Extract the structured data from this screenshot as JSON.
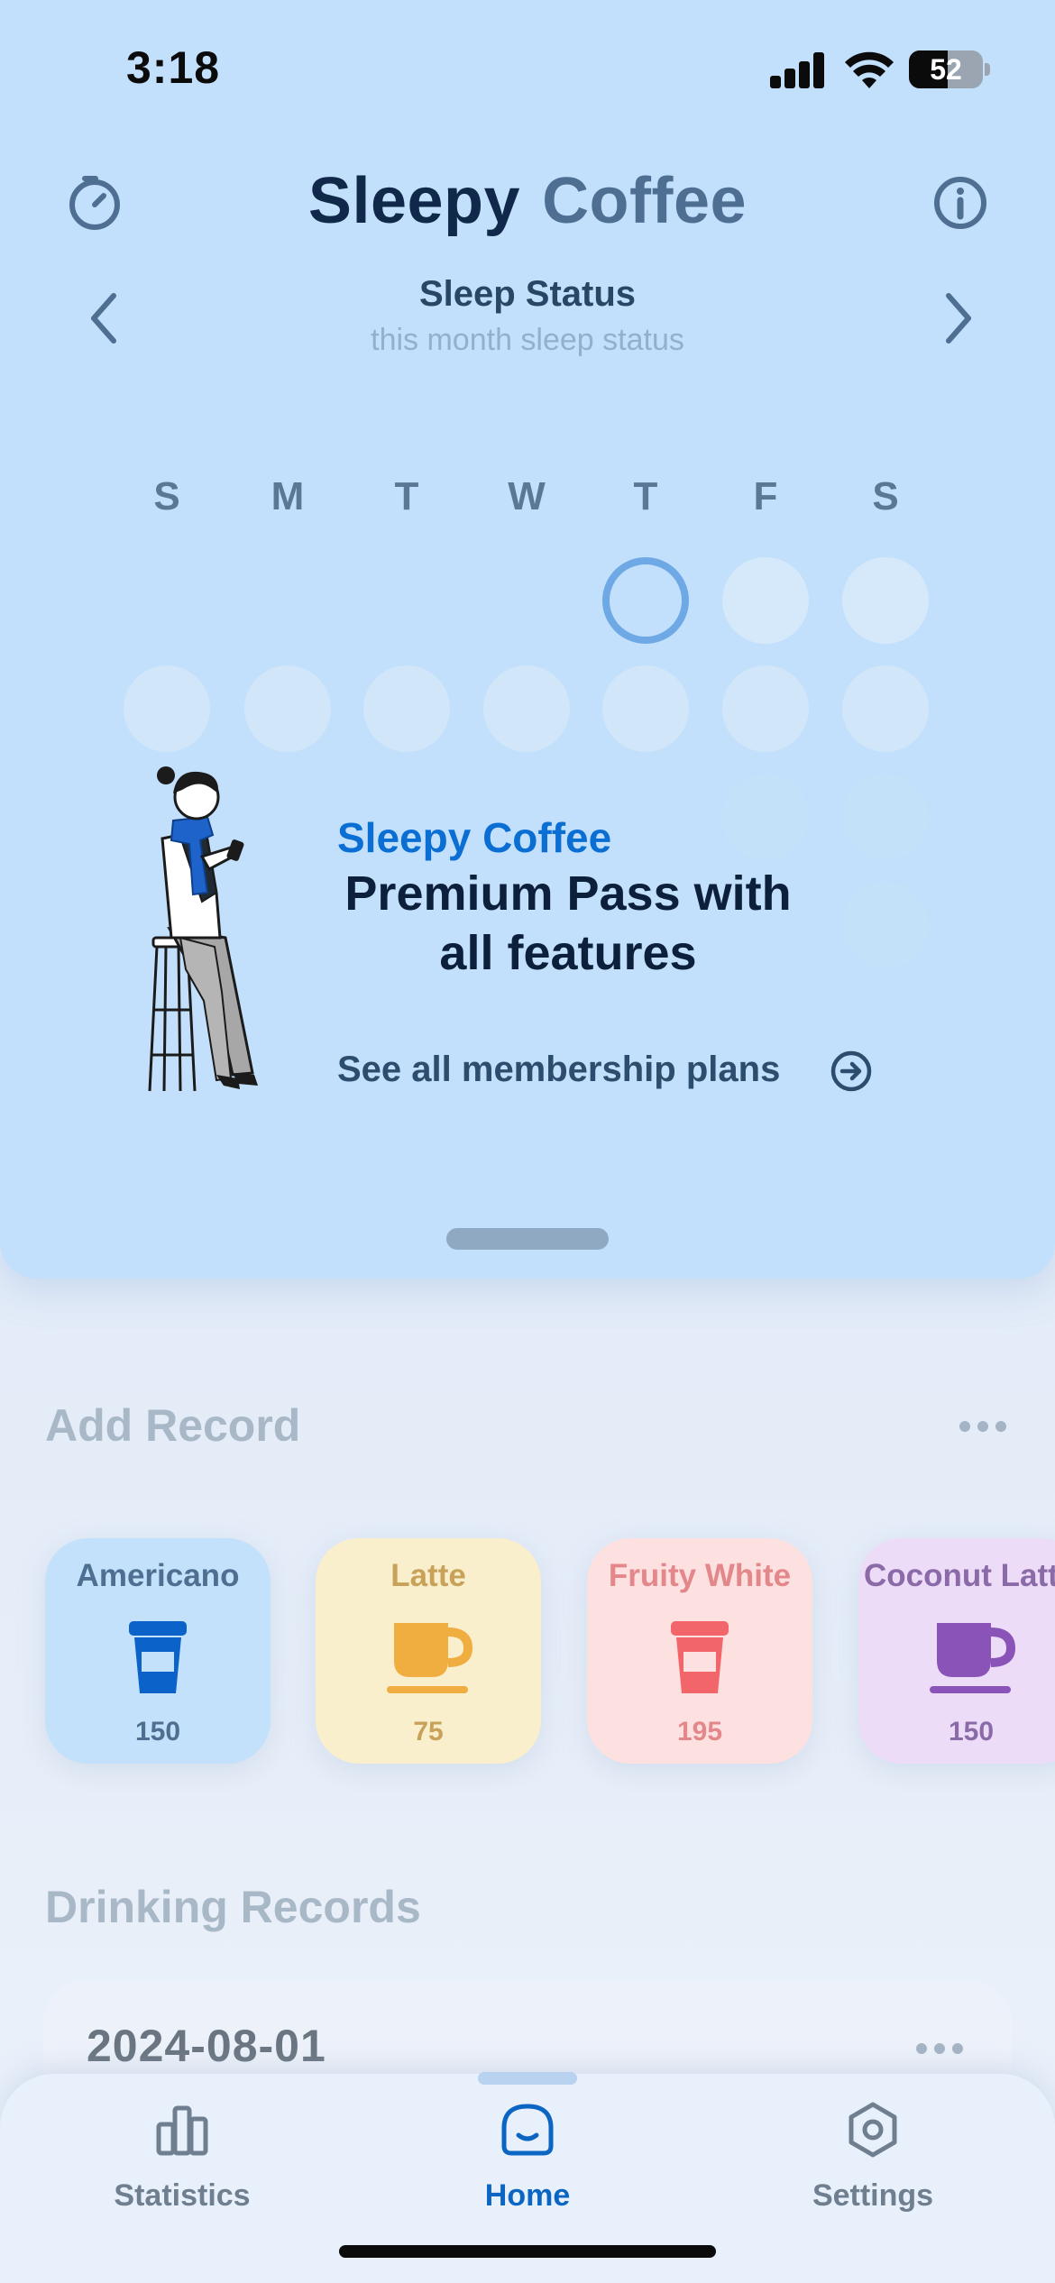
{
  "status_bar": {
    "time": "3:18",
    "battery": "52",
    "battery_level": 0.52
  },
  "header": {
    "title_part1": "Sleepy",
    "title_part2": "Coffee",
    "left_icon": "timer-icon",
    "right_icon": "info-icon"
  },
  "sleep_status": {
    "title": "Sleep Status",
    "subtitle": "this month sleep status",
    "weekdays": [
      "S",
      "M",
      "T",
      "W",
      "T",
      "F",
      "S"
    ]
  },
  "promo": {
    "brand": "Sleepy Coffee",
    "title_line1": "Premium Pass with",
    "title_line2": "all features",
    "link": "See all membership plans"
  },
  "add_record": {
    "title": "Add Record",
    "drinks": [
      {
        "name": "Americano",
        "value": "150",
        "icon": "cup-icon",
        "bg": "#c3e1fb",
        "color": "#0b62c9",
        "label_color": "#4f6f92"
      },
      {
        "name": "Latte",
        "value": "75",
        "icon": "mug-icon",
        "bg": "#f9efcd",
        "color": "#f0ad40",
        "label_color": "#c9a25a"
      },
      {
        "name": "Fruity White",
        "value": "195",
        "icon": "cup-icon",
        "bg": "#fde1e1",
        "color": "#f2666b",
        "label_color": "#e4878a"
      },
      {
        "name": "Coconut Latte",
        "value": "150",
        "icon": "mug-icon",
        "bg": "#ecdcf8",
        "color": "#8a53b8",
        "label_color": "#8b6aa8"
      }
    ]
  },
  "drinking_records": {
    "title": "Drinking Records",
    "entries": [
      {
        "date": "2024-08-01"
      }
    ]
  },
  "tabs": [
    {
      "label": "Statistics",
      "icon": "bar-chart-icon",
      "active": false
    },
    {
      "label": "Home",
      "icon": "home-face-icon",
      "active": true
    },
    {
      "label": "Settings",
      "icon": "gear-hexagon-icon",
      "active": false
    }
  ]
}
